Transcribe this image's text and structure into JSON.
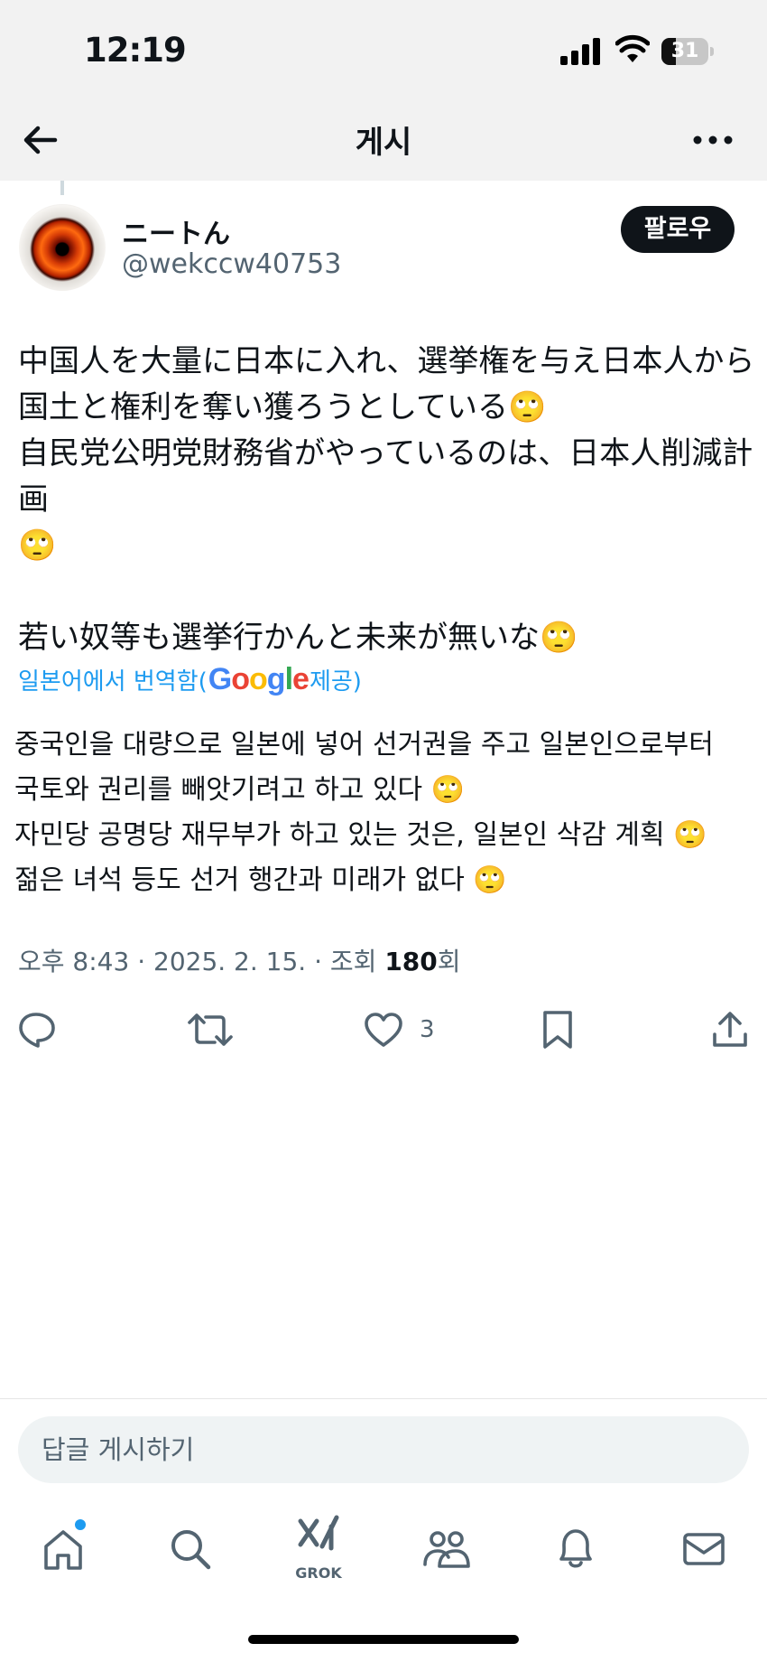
{
  "status_bar": {
    "time": "12:19",
    "battery": "31",
    "battery_level": 0.31
  },
  "header": {
    "title": "게시",
    "back_icon": "arrow-left-icon",
    "more_icon": "more-horizontal-icon"
  },
  "author": {
    "display_name": "ニートん",
    "handle": "@wekccw40753",
    "follow_label": "팔로우"
  },
  "tweet": {
    "text": "中国人を大量に日本に入れ、選挙権を与え日本人から\n国土と権利を奪い獲ろうとしている🙄\n自民党公明党財務省がやっているのは、日本人削減計画\n🙄\n\n若い奴等も選挙行かんと未来が無いな🙄",
    "translation_prefix": "일본어에서 번역함(",
    "translation_provider": "Google",
    "translation_suffix": " 제공)",
    "translated_text": "중국인을 대량으로 일본에 넣어 선거권을 주고 일본인으로부터\n국토와 권리를 빼앗기려고 하고 있다 🙄\n자민당 공명당 재무부가 하고 있는 것은, 일본인 삭감 계획 🙄\n젊은 녀석 등도 선거 행간과 미래가 없다 🙄",
    "meta_prefix": "오후 8:43 · 2025. 2. 15. · 조회 ",
    "views": "180",
    "meta_suffix": "회"
  },
  "actions": {
    "reply_icon": "reply-icon",
    "repost_icon": "repost-icon",
    "like_icon": "heart-icon",
    "like_count": "3",
    "bookmark_icon": "bookmark-icon",
    "share_icon": "share-icon"
  },
  "reply_composer": {
    "placeholder": "답글 게시하기"
  },
  "bottom_nav": {
    "items": [
      {
        "icon": "home-icon"
      },
      {
        "icon": "search-icon"
      },
      {
        "icon": "grok-icon",
        "label": "GROK"
      },
      {
        "icon": "communities-icon"
      },
      {
        "icon": "bell-icon"
      },
      {
        "icon": "mail-icon"
      }
    ]
  },
  "colors": {
    "accent": "#1d9bf0",
    "text": "#0f1419",
    "secondary": "#536471"
  }
}
